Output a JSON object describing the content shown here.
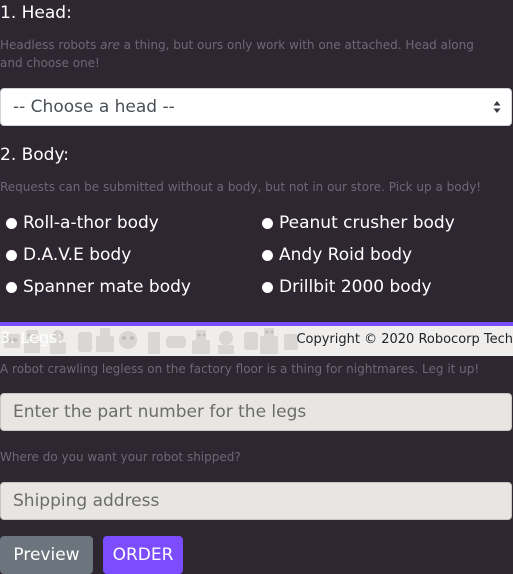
{
  "head": {
    "heading": "1. Head:",
    "help_before": "Headless robots ",
    "help_em": "are",
    "help_after": " a thing, but ours only work with one attached. Head along and choose one!",
    "select_value": "-- Choose a head --"
  },
  "body": {
    "heading": "2. Body:",
    "help": "Requests can be submitted without a body, but not in our store. Pick up a body!",
    "options": [
      "Roll-a-thor body",
      "Peanut crusher body",
      "D.A.V.E body",
      "Andy Roid body",
      "Spanner mate body",
      "Drillbit 2000 body"
    ]
  },
  "legs": {
    "heading": "3. Legs:",
    "help": "A robot crawling legless on the factory floor is a thing for nightmares. Leg it up!",
    "placeholder": "Enter the part number for the legs"
  },
  "footer": {
    "copyright": "Copyright © 2020 Robocorp Tech"
  },
  "shipping": {
    "help": "Where do you want your robot shipped?",
    "placeholder": "Shipping address"
  },
  "buttons": {
    "preview": "Preview",
    "order": "ORDER"
  },
  "colors": {
    "background": "#2e2630",
    "accent": "#7c4dff",
    "secondary_button": "#6c757d"
  }
}
